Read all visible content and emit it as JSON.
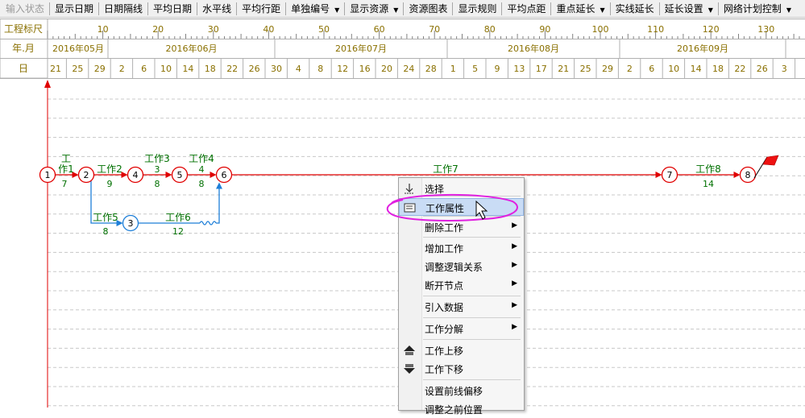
{
  "toolbar": {
    "items": [
      {
        "label": "输入状态",
        "disabled": true,
        "dropdown": false
      },
      {
        "label": "显示日期",
        "disabled": false,
        "dropdown": false
      },
      {
        "label": "日期隔线",
        "disabled": false,
        "dropdown": false
      },
      {
        "label": "平均日期",
        "disabled": false,
        "dropdown": false
      },
      {
        "label": "水平线",
        "disabled": false,
        "dropdown": false
      },
      {
        "label": "平均行距",
        "disabled": false,
        "dropdown": false
      },
      {
        "label": "单独编号",
        "disabled": false,
        "dropdown": true
      },
      {
        "label": "显示资源",
        "disabled": false,
        "dropdown": true
      },
      {
        "label": "资源图表",
        "disabled": false,
        "dropdown": false
      },
      {
        "label": "显示规则",
        "disabled": false,
        "dropdown": false
      },
      {
        "label": "平均点距",
        "disabled": false,
        "dropdown": false
      },
      {
        "label": "重点延长",
        "disabled": false,
        "dropdown": true
      },
      {
        "label": "实线延长",
        "disabled": false,
        "dropdown": false
      },
      {
        "label": "延长设置",
        "disabled": false,
        "dropdown": true
      },
      {
        "label": "网络计划控制",
        "disabled": false,
        "dropdown": true
      }
    ]
  },
  "timescale": {
    "row_labels": [
      "工程标尺",
      "年.月",
      "日"
    ],
    "scale_ticks": [
      "10",
      "20",
      "30",
      "40",
      "50",
      "60",
      "70",
      "80",
      "90",
      "100",
      "110",
      "120",
      "130"
    ],
    "months": [
      "2016年05月",
      "2016年06月",
      "2016年07月",
      "2016年08月",
      "2016年09月"
    ],
    "days": [
      "21",
      "25",
      "29",
      "2",
      "6",
      "10",
      "14",
      "18",
      "22",
      "26",
      "30",
      "4",
      "8",
      "12",
      "16",
      "20",
      "24",
      "28",
      "1",
      "5",
      "9",
      "13",
      "17",
      "21",
      "25",
      "29",
      "2",
      "6",
      "10",
      "14",
      "18",
      "22",
      "26",
      "3"
    ]
  },
  "network": {
    "nodes": [
      "1",
      "2",
      "3",
      "4",
      "5",
      "6",
      "7",
      "8"
    ],
    "works": [
      {
        "name": "工作1",
        "duration": "7"
      },
      {
        "name": "工作2",
        "duration": "9"
      },
      {
        "name": "工作3",
        "duration": "8"
      },
      {
        "name": "工作4",
        "duration": "8"
      },
      {
        "name": "工作5",
        "duration": "8"
      },
      {
        "name": "工作6",
        "duration": "12"
      },
      {
        "name": "工作7",
        "duration": ""
      },
      {
        "name": "工作8",
        "duration": "14"
      }
    ]
  },
  "context_menu": {
    "items": [
      {
        "label": "选择",
        "icon": "select-icon",
        "submenu": false,
        "highlighted": false
      },
      {
        "label": "工作属性",
        "icon": "properties-icon",
        "submenu": false,
        "highlighted": true
      },
      {
        "label": "删除工作",
        "icon": "",
        "submenu": true,
        "highlighted": false
      },
      {
        "label": "增加工作",
        "icon": "",
        "submenu": true,
        "highlighted": false
      },
      {
        "label": "调整逻辑关系",
        "icon": "",
        "submenu": true,
        "highlighted": false
      },
      {
        "label": "断开节点",
        "icon": "",
        "submenu": true,
        "highlighted": false
      },
      {
        "label": "引入数据",
        "icon": "",
        "submenu": true,
        "highlighted": false
      },
      {
        "label": "工作分解",
        "icon": "",
        "submenu": true,
        "highlighted": false
      },
      {
        "label": "工作上移",
        "icon": "move-up-icon",
        "submenu": false,
        "highlighted": false
      },
      {
        "label": "工作下移",
        "icon": "move-down-icon",
        "submenu": false,
        "highlighted": false
      },
      {
        "label": "设置前线偏移",
        "icon": "",
        "submenu": false,
        "highlighted": false
      },
      {
        "label": "调整之前位置",
        "icon": "",
        "submenu": false,
        "highlighted": false
      }
    ]
  },
  "colors": {
    "critical": "#e00000",
    "normal": "#1e7fd8",
    "label": "#007000",
    "axis_text": "#8a7000",
    "annotation": "#e020e0"
  }
}
